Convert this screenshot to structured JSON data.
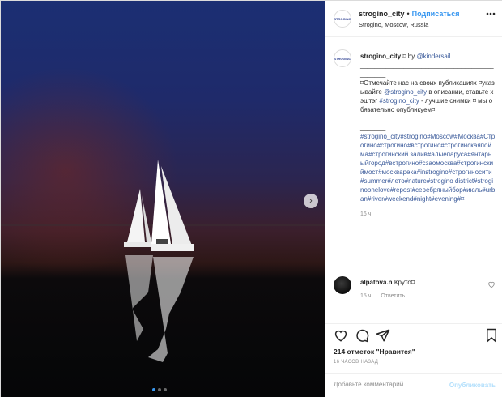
{
  "header": {
    "avatar_text": "STROGINO",
    "username": "strogino_city",
    "separator": "•",
    "follow_label": "Подписаться",
    "location": "Strogino, Moscow, Russia",
    "more_icon": "more-horizontal-icon"
  },
  "photo": {
    "next_icon": "chevron-right-icon",
    "next_glyph": "›",
    "carousel_count": 3,
    "carousel_active_index": 0
  },
  "caption": {
    "username": "strogino_city",
    "by_text": " ⌑ by ",
    "mention": "@kindersail",
    "line_rule": "____________________________________________",
    "body_1": "⌑Отмечайте нас на своих публикациях ⌑указывайте ",
    "handle": "@strogino_city",
    "body_2": " в описании, ставьте хэштэг ",
    "hashtag": "#strogino_city",
    "body_3": " - лучшие снимки ⌑ мы обязательно опубликуем⌑",
    "line_rule_2": "____________________________________________",
    "tags": "#strogino_city#strogino#Moscow#Москва#Строгино#строгино#встрогино#строгинскаяпойма#строгинский залив#алыепаруса#янтарныйгород#встрогино#сзаомосква#строгинскиймост#москварека#instrogino#строгиносити#summer#лето#nature#strogino district#stroginoonelove#repost#серебряныйбор#июль#urban#river#weekend#night#evening#⌑",
    "time": "16 ч."
  },
  "comment": {
    "username": "alpatova.n",
    "text": "Круто⌑",
    "time": "15 ч.",
    "reply_label": "Ответить"
  },
  "actions": {
    "like_icon": "heart-icon",
    "comment_icon": "comment-icon",
    "share_icon": "share-icon",
    "save_icon": "bookmark-icon",
    "likes_text": "214 отметок \"Нравится\"",
    "time_ago": "16 ЧАСОВ НАЗАД"
  },
  "add_comment": {
    "placeholder": "Добавьте комментарий...",
    "publish_label": "Опубликовать"
  },
  "colors": {
    "accent_blue": "#3897f0",
    "link_blue": "#3a5a9a",
    "muted_gray": "#8e8e8e",
    "publish_disabled": "#b2dffc"
  }
}
